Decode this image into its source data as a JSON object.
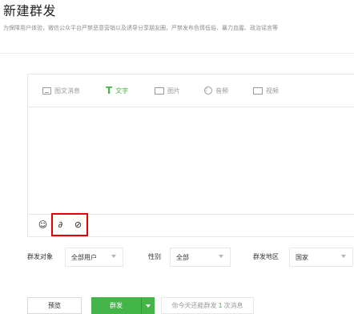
{
  "page": {
    "title": "新建群发",
    "notice": "为保障用户体验，微信公众平台严禁恶意营销以及诱导分享朋友圈，严禁发布色情低俗、暴力血腥、政治谣言等"
  },
  "editor": {
    "tabs": [
      {
        "label": "图文消息",
        "icon": "news-icon",
        "active": false
      },
      {
        "label": "文字",
        "icon": "text-T-icon",
        "active": true
      },
      {
        "label": "图片",
        "icon": "image-icon",
        "active": false
      },
      {
        "label": "音频",
        "icon": "audio-icon",
        "active": false
      },
      {
        "label": "视频",
        "icon": "video-icon",
        "active": false
      }
    ],
    "text_tab_icon": "T",
    "audio_icon_glyph": "♪",
    "video_icon_glyph": "▷",
    "content": "",
    "tools": [
      {
        "name": "emoji-icon",
        "glyph": "☺"
      },
      {
        "name": "link-icon",
        "glyph": "∂"
      },
      {
        "name": "unlink-icon",
        "glyph": "⊘"
      }
    ]
  },
  "filters": {
    "target_label": "群发对象",
    "target_value": "全部用户",
    "gender_label": "性别",
    "gender_value": "全部",
    "region_label": "群发地区",
    "region_value": "国家"
  },
  "actions": {
    "preview_label": "预览",
    "send_label": "群发",
    "quota_prefix": "你今天还能群发",
    "quota_count": "1",
    "quota_suffix": "次消息"
  },
  "colors": {
    "accent": "#44b549",
    "highlight": "#e40000"
  }
}
